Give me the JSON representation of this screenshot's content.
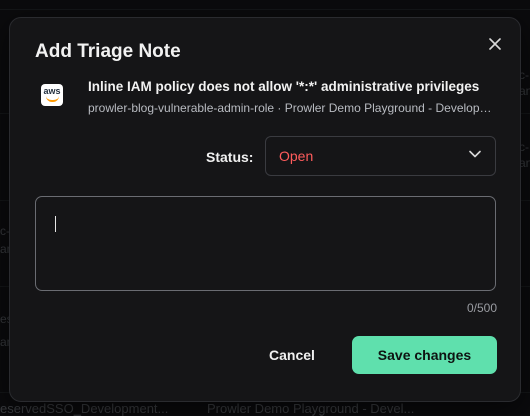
{
  "background": {
    "fragments": [
      "c-",
      "an",
      "c-",
      "an",
      "c-",
      "an",
      "es",
      "an"
    ],
    "bottom_row": {
      "resource": "eservedSSO_Development...",
      "account": "Prowler Demo Playground - Devel..."
    }
  },
  "modal": {
    "title": "Add Triage Note",
    "close_icon": "close-icon",
    "finding": {
      "provider_icon": "aws-icon",
      "provider_label": "aws",
      "title": "Inline IAM policy does not allow '*:*' administrative privileges",
      "subtitle": "prowler-blog-vulnerable-admin-role · Prowler Demo Playground - Development"
    },
    "status": {
      "label": "Status:",
      "value": "Open",
      "value_color": "#ff5c5c"
    },
    "note": {
      "value": "",
      "counter": "0/500"
    },
    "actions": {
      "cancel_label": "Cancel",
      "save_label": "Save changes",
      "save_color": "#5fe0ad"
    }
  }
}
